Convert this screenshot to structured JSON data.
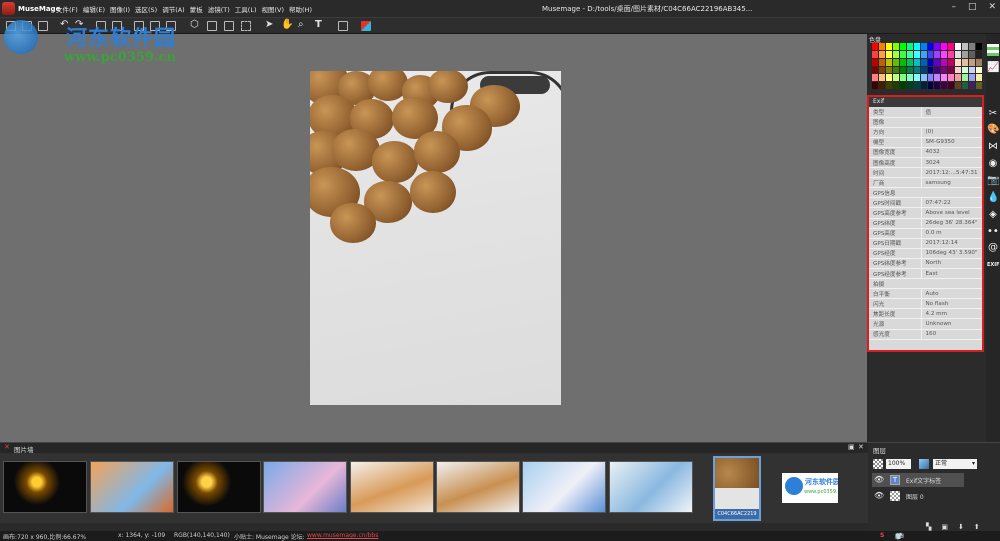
{
  "titlebar": {
    "app_name": "MuseMage",
    "window_title": "Musemage - D:/tools/桌面/图片素材/C04C66AC22196AB345...",
    "menu": [
      "文件(F)",
      "编辑(E)",
      "图像(I)",
      "选区(S)",
      "调节(A)",
      "蒙板",
      "滤镜(T)",
      "工具(L)",
      "视图(V)",
      "帮助(H)"
    ],
    "controls": [
      "–",
      "□",
      "✕"
    ]
  },
  "watermark": {
    "name": "河东软件园",
    "url": "www.pc0359.cn"
  },
  "swatch_panel": {
    "title": "色盘",
    "colors": [
      "#ff0000",
      "#ff8000",
      "#ffff00",
      "#80ff00",
      "#00ff00",
      "#00ff80",
      "#00ffff",
      "#0080ff",
      "#0000ff",
      "#8000ff",
      "#ff00ff",
      "#ff0080",
      "#ffffff",
      "#c0c0c0",
      "#808080",
      "#000000",
      "#ff4040",
      "#ffa040",
      "#ffff40",
      "#a0ff40",
      "#40ff40",
      "#40ffa0",
      "#40ffff",
      "#40a0ff",
      "#4040ff",
      "#a040ff",
      "#ff40ff",
      "#ff40a0",
      "#e0e0e0",
      "#a0a0a0",
      "#606060",
      "#202020",
      "#c00000",
      "#c06000",
      "#c0c000",
      "#60c000",
      "#00c000",
      "#00c060",
      "#00c0c0",
      "#0060c0",
      "#0000c0",
      "#6000c0",
      "#c000c0",
      "#c00060",
      "#ffe0c0",
      "#e0c0a0",
      "#c0a080",
      "#a08060",
      "#800000",
      "#804000",
      "#808000",
      "#408000",
      "#008000",
      "#008040",
      "#008080",
      "#004080",
      "#000080",
      "#400080",
      "#800080",
      "#800040",
      "#ffd0d0",
      "#d0ffd0",
      "#d0d0ff",
      "#ffffd0",
      "#ff8080",
      "#ffc080",
      "#ffff80",
      "#c0ff80",
      "#80ff80",
      "#80ffc0",
      "#80ffff",
      "#80c0ff",
      "#8080ff",
      "#c080ff",
      "#ff80ff",
      "#ff80c0",
      "#f0a0a0",
      "#a0f0a0",
      "#a0a0f0",
      "#f0f0a0",
      "#400000",
      "#402000",
      "#404000",
      "#204000",
      "#004000",
      "#004020",
      "#004040",
      "#002040",
      "#000040",
      "#200040",
      "#400040",
      "#400020",
      "#604020",
      "#206040",
      "#402060",
      "#606020"
    ]
  },
  "exif": {
    "title": "Exif",
    "header": [
      "类型",
      "值"
    ],
    "sections": [
      {
        "name": "图像",
        "rows": [
          [
            "方向",
            "(0)"
          ],
          [
            "機型",
            "SM-G9350"
          ],
          [
            "图像宽度",
            "4032"
          ],
          [
            "图像高度",
            "3024"
          ],
          [
            "时间",
            "2017:12:...5:47:31"
          ],
          [
            "厂商",
            "samsung"
          ]
        ]
      },
      {
        "name": "GPS信息",
        "rows": [
          [
            "GPS时间戳",
            "07:47:22"
          ],
          [
            "GPS高度参考",
            "Above sea level"
          ],
          [
            "GPS纬度",
            "26deg 36' 28.364\""
          ],
          [
            "GPS高度",
            "0.0 m"
          ],
          [
            "GPS日期戳",
            "2017:12:14"
          ],
          [
            "GPS经度",
            "106deg 43' 3.590\""
          ],
          [
            "GPS纬度参考",
            "North"
          ],
          [
            "GPS经度参考",
            "East"
          ]
        ]
      },
      {
        "name": "拍摄",
        "rows": [
          [
            "白平衡",
            "Auto"
          ],
          [
            "闪光",
            "No flash"
          ],
          [
            "焦距长度",
            "4.2 mm"
          ],
          [
            "光源",
            "Unknown"
          ],
          [
            "感光度",
            "160"
          ]
        ]
      }
    ]
  },
  "side_icons": [
    "brush-icon",
    "palette-icon",
    "bowtie-icon",
    "color-wheel-icon",
    "camera-icon",
    "drop-icon",
    "diamond-icon",
    "dots-icon",
    "at-icon"
  ],
  "side_exif_label": "EXIF",
  "filmstrip": {
    "title": "图片墙",
    "selected_label": "C04C66AC2219"
  },
  "layers": {
    "title": "图层",
    "zoom": "100%",
    "blend_mode": "正常",
    "items": [
      {
        "name": "Exif文字标签",
        "glyph": "T"
      },
      {
        "name": "图层 0"
      }
    ]
  },
  "status": {
    "size": "画布:720 x 960,比例:66.67%",
    "coords": "x: 1364, y: -109",
    "rgb": "RGB(140,140,140)",
    "tip": "小贴士: Musemage 论坛:",
    "link": "www.musemage.cn/bbs"
  }
}
